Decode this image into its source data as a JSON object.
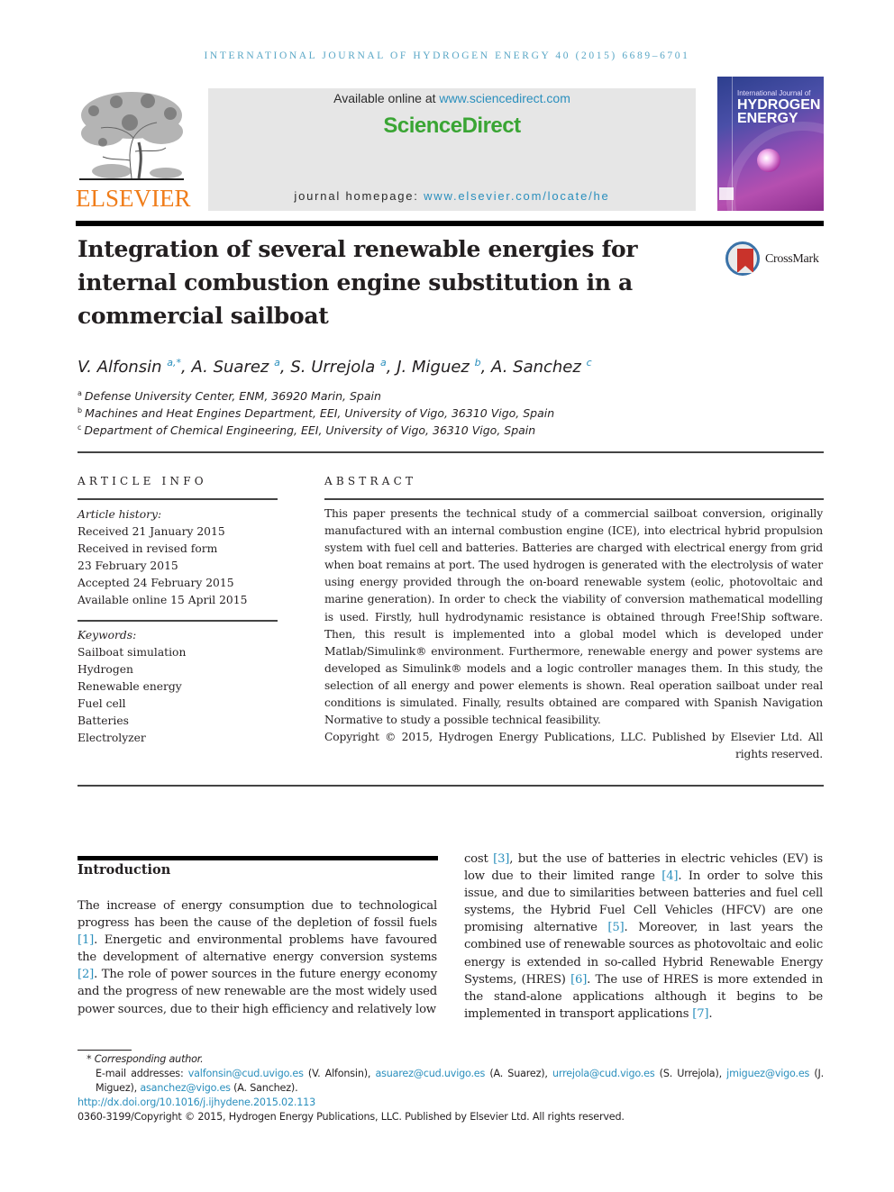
{
  "header": {
    "running_head": "International Journal of Hydrogen Energy 40 (2015) 6689–6701",
    "publisher_name": "ELSEVIER",
    "available_online_prefix": "Available online at ",
    "available_online_url": "www.sciencedirect.com",
    "sciencedirect_brand": "ScienceDirect",
    "homepage_prefix": "journal homepage: ",
    "homepage_url": "www.elsevier.com/locate/he",
    "cover": {
      "line1": "International Journal of",
      "line2": "HYDROGEN",
      "line3": "ENERGY"
    },
    "crossmark_label": "CrossMark"
  },
  "article": {
    "title": "Integration of several renewable energies for internal combustion engine substitution in a commercial sailboat",
    "authors": [
      {
        "name": "V. Alfonsin",
        "sup": "a,*"
      },
      {
        "name": "A. Suarez",
        "sup": "a"
      },
      {
        "name": "S. Urrejola",
        "sup": "a"
      },
      {
        "name": "J. Miguez",
        "sup": "b"
      },
      {
        "name": "A. Sanchez",
        "sup": "c"
      }
    ],
    "author_separator": ", ",
    "affiliations": [
      {
        "key": "a",
        "text": "Defense University Center, ENM, 36920 Marin, Spain"
      },
      {
        "key": "b",
        "text": "Machines and Heat Engines Department, EEI, University of Vigo, 36310 Vigo, Spain"
      },
      {
        "key": "c",
        "text": "Department of Chemical Engineering, EEI, University of Vigo, 36310 Vigo, Spain"
      }
    ]
  },
  "article_info": {
    "heading": "ARTICLE INFO",
    "history_label": "Article history:",
    "history": [
      "Received 21 January 2015",
      "Received in revised form",
      "23 February 2015",
      "Accepted 24 February 2015",
      "Available online 15 April 2015"
    ],
    "keywords_label": "Keywords:",
    "keywords": [
      "Sailboat simulation",
      "Hydrogen",
      "Renewable energy",
      "Fuel cell",
      "Batteries",
      "Electrolyzer"
    ]
  },
  "abstract": {
    "heading": "ABSTRACT",
    "text": "This paper presents the technical study of a commercial sailboat conversion, originally manufactured with an internal combustion engine (ICE), into electrical hybrid propulsion system with fuel cell and batteries. Batteries are charged with electrical energy from grid when boat remains at port. The used hydrogen is generated with the electrolysis of water using energy provided through the on-board renewable system (eolic, photovoltaic and marine generation). In order to check the viability of conversion mathematical modelling is used. Firstly, hull hydrodynamic resistance is obtained through Free!Ship software. Then, this result is implemented into a global model which is developed under Matlab/Simulink® environment. Furthermore, renewable energy and power systems are developed as Simulink® models and a logic controller manages them. In this study, the selection of all energy and power elements is shown. Real operation sailboat under real conditions is simulated. Finally, results obtained are compared with Spanish Navigation Normative to study a possible technical feasibility.",
    "copyright": "Copyright © 2015, Hydrogen Energy Publications, LLC. Published by Elsevier Ltd. All rights reserved."
  },
  "introduction": {
    "heading": "Introduction",
    "left_segments": [
      {
        "t": "The increase of energy consumption due to technological progress has been the cause of the depletion of fossil fuels "
      },
      {
        "c": "[1]"
      },
      {
        "t": ". Energetic and environmental problems have favoured the development of alternative energy conversion systems "
      },
      {
        "c": "[2]"
      },
      {
        "t": ". The role of power sources in the future energy economy and the progress of new renewable are the most widely used power sources, due to their high efficiency and relatively low"
      }
    ],
    "right_segments": [
      {
        "t": "cost "
      },
      {
        "c": "[3]"
      },
      {
        "t": ", but the use of batteries in electric vehicles (EV) is low due to their limited range "
      },
      {
        "c": "[4]"
      },
      {
        "t": ". In order to solve this issue, and due to similarities between batteries and fuel cell systems, the Hybrid Fuel Cell Vehicles (HFCV) are one promising alternative "
      },
      {
        "c": "[5]"
      },
      {
        "t": ". Moreover, in last years the combined use of renewable sources as photovoltaic and eolic energy is extended in so-called Hybrid Renewable Energy Systems, (HRES) "
      },
      {
        "c": "[6]"
      },
      {
        "t": ". The use of HRES is more extended in the stand-alone applications although it begins to be implemented in transport applica­tions "
      },
      {
        "c": "[7]"
      },
      {
        "t": "."
      }
    ]
  },
  "footnotes": {
    "corresponding_marker": "*",
    "corresponding_text": "Corresponding author.",
    "email_label": "E-mail addresses: ",
    "emails": [
      {
        "address": "valfonsin@cud.uvigo.es",
        "owner": " (V. Alfonsin), "
      },
      {
        "address": "asuarez@cud.uvigo.es",
        "owner": " (A. Suarez), "
      },
      {
        "address": "urrejola@cud.vigo.es",
        "owner": " (S. Urrejola), "
      },
      {
        "address": "jmi­guez@vigo.es",
        "owner": " (J. Miguez), "
      },
      {
        "address": "asanchez@vigo.es",
        "owner": " (A. Sanchez)."
      }
    ],
    "doi": "http://dx.doi.org/10.1016/j.ijhydene.2015.02.113",
    "issn_copyright": "0360-3199/Copyright © 2015, Hydrogen Energy Publications, LLC. Published by Elsevier Ltd. All rights reserved."
  },
  "colors": {
    "link": "#2a8fbd",
    "running_head": "#5aa7c6",
    "elsevier_orange": "#f07d1a",
    "sciencedirect_green": "#3aa534",
    "banner_gray": "#e6e6e6"
  }
}
